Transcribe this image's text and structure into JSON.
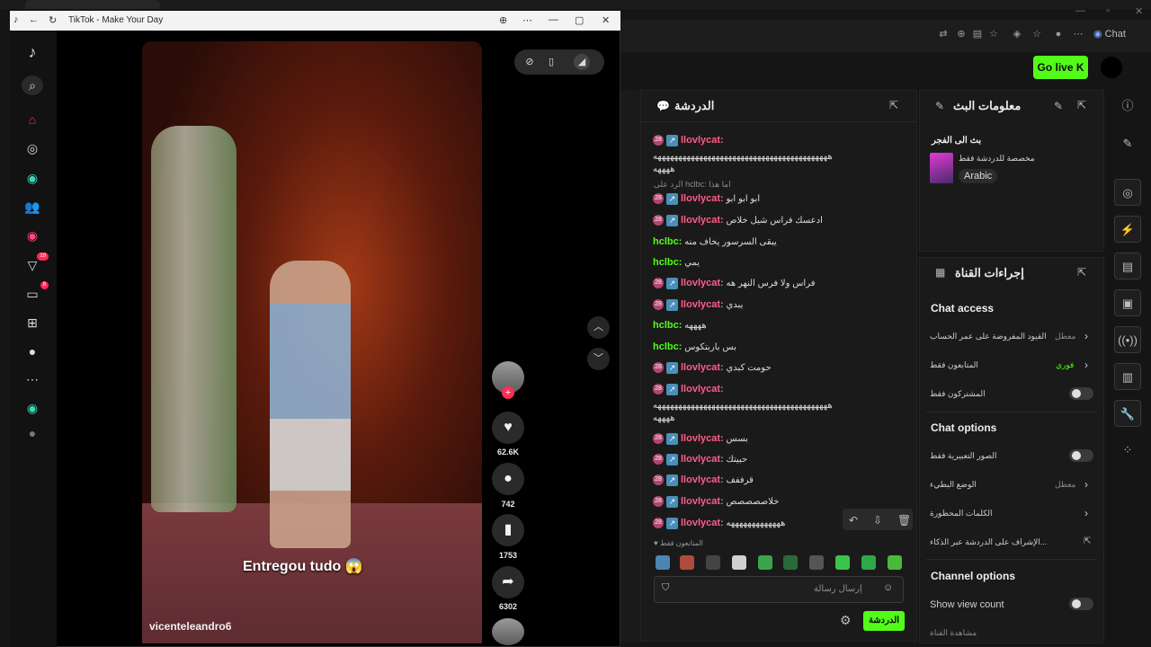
{
  "tiktok_window": {
    "title": "TikTok - Make Your Day",
    "sidebar_badges": {
      "activity": "19",
      "messages": "8"
    },
    "video": {
      "caption": "Entregou tudo 😱",
      "username": "vicenteleandro6",
      "likes": "62.6K",
      "comments": "742",
      "bookmarks": "1753",
      "shares": "6302"
    }
  },
  "browser": {
    "chat_label": "Chat",
    "go_live_label": "Go live"
  },
  "chat": {
    "title": "الدردشة",
    "messages": [
      {
        "user": "llovlycat:",
        "text": "",
        "color": "red"
      },
      {
        "user": "",
        "text": "ههههههههههههههههههههههههههههههههههههههههههه",
        "color": "none"
      },
      {
        "user": "",
        "text": "ههههه",
        "color": "none"
      },
      {
        "user": "llovlycat:",
        "text": "ابو ابو ابو",
        "color": "red"
      },
      {
        "user": "llovlycat:",
        "text": "ادعسك فراس شيل خلاص",
        "color": "red"
      },
      {
        "user": "hclbc:",
        "text": "يبقى السرسور يخاف منه",
        "color": "green"
      },
      {
        "user": "hclbc:",
        "text": "يمي",
        "color": "green"
      },
      {
        "user": "llovlycat:",
        "text": "فراس ولا فرس النهر هه",
        "color": "red"
      },
      {
        "user": "llovlycat:",
        "text": "يبدي",
        "color": "red"
      },
      {
        "user": "hclbc:",
        "text": "ههههه",
        "color": "green"
      },
      {
        "user": "hclbc:",
        "text": "بس باربتكوس",
        "color": "green"
      },
      {
        "user": "llovlycat:",
        "text": "حومت كبدي",
        "color": "red"
      },
      {
        "user": "llovlycat:",
        "text": "",
        "color": "red"
      },
      {
        "user": "",
        "text": "ههههههههههههههههههههههههههههههههههههههههههه",
        "color": "none"
      },
      {
        "user": "",
        "text": "ههههه",
        "color": "none"
      },
      {
        "user": "llovlycat:",
        "text": "بسس",
        "color": "red"
      },
      {
        "user": "llovlycat:",
        "text": "حبيتك",
        "color": "red"
      },
      {
        "user": "llovlycat:",
        "text": "قرففف",
        "color": "red"
      },
      {
        "user": "llovlycat:",
        "text": "خلاصصصصص",
        "color": "red"
      },
      {
        "user": "llovlycat:",
        "text": "هههههههههههههه",
        "color": "red"
      }
    ],
    "reply_line": "الرد على hclbc: اما هذا",
    "followers_only_note": "المتابعون فقط",
    "input_placeholder": "إرسال رسالة",
    "send_label": "الدردشة"
  },
  "stream_info": {
    "title": "معلومات البث",
    "stream_title": "بث الى الفجر",
    "category": "مخصصة للدردشة فقط",
    "language": "Arabic"
  },
  "channel_actions": {
    "title": "إجراءات القناة",
    "chat_access": "Chat access",
    "account_age": "القيود المفروضة على عمر الحساب",
    "account_age_value": "معطل",
    "followers_only": "المتابعون فقط",
    "followers_only_value": "فوري",
    "subscribers_only": "المشتركون فقط",
    "chat_options": "Chat options",
    "emotes_only": "الصور التعبيرية فقط",
    "slow_mode": "الوضع البطيء",
    "slow_mode_value": "معطل",
    "banned_words": "الكلمات المحظورة",
    "ai_moderation": "الإشراف على الدردشة عبر الذكاء...",
    "channel_options": "Channel options",
    "show_view_count": "Show view count",
    "footer_partial": "مشاهدة القناة"
  },
  "colors": {
    "accent": "#53fc18",
    "tiktok_red": "#fe2c55",
    "chat_red": "#ff5c8a"
  }
}
